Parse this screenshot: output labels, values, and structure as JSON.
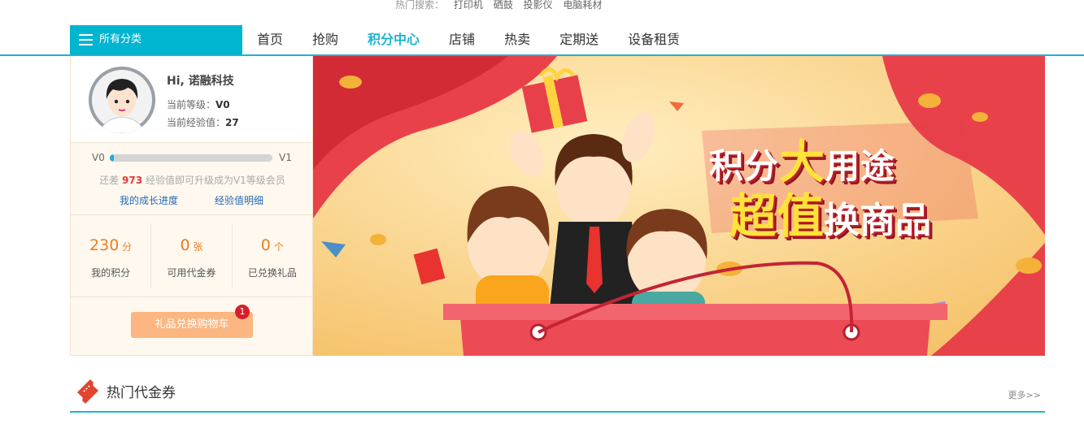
{
  "hot_search": {
    "label": "热门搜索：",
    "keywords": [
      "打印机",
      "硒鼓",
      "投影仪",
      "电脑耗材"
    ]
  },
  "nav": {
    "category_label": "所有分类",
    "links": [
      {
        "label": "首页",
        "active": false
      },
      {
        "label": "抢购",
        "active": false
      },
      {
        "label": "积分中心",
        "active": true
      },
      {
        "label": "店铺",
        "active": false
      },
      {
        "label": "热卖",
        "active": false
      },
      {
        "label": "定期送",
        "active": false
      },
      {
        "label": "设备租赁",
        "active": false
      }
    ]
  },
  "user": {
    "greeting": "Hi, 诺融科技",
    "level_label": "当前等级：",
    "level_value": "V0",
    "exp_label": "当前经验值：",
    "exp_value": "27"
  },
  "progress": {
    "from": "V0",
    "to": "V1",
    "fraction": 0.027,
    "tip_prefix": "还差",
    "tip_value": "973",
    "tip_suffix": "经验值即可升级成为V1等级会员",
    "link_growth": "我的成长进度",
    "link_exp": "经验值明细"
  },
  "stats": [
    {
      "value": "230",
      "unit": "分",
      "label": "我的积分"
    },
    {
      "value": "0",
      "unit": "张",
      "label": "可用代金券"
    },
    {
      "value": "0",
      "unit": "个",
      "label": "已兑换礼品"
    }
  ],
  "cart": {
    "label": "礼品兑换购物车",
    "badge": "1"
  },
  "banner": {
    "line1_a": "积分",
    "line1_b": "大",
    "line1_c": "用途",
    "line2_a": "超值",
    "line2_b": "换商品"
  },
  "section": {
    "title": "热门代金券",
    "more": "更多>>"
  },
  "colors": {
    "accent": "#00b5d0",
    "orange": "#f07c1c",
    "cart": "#fbb682",
    "badge": "#d4202a"
  }
}
